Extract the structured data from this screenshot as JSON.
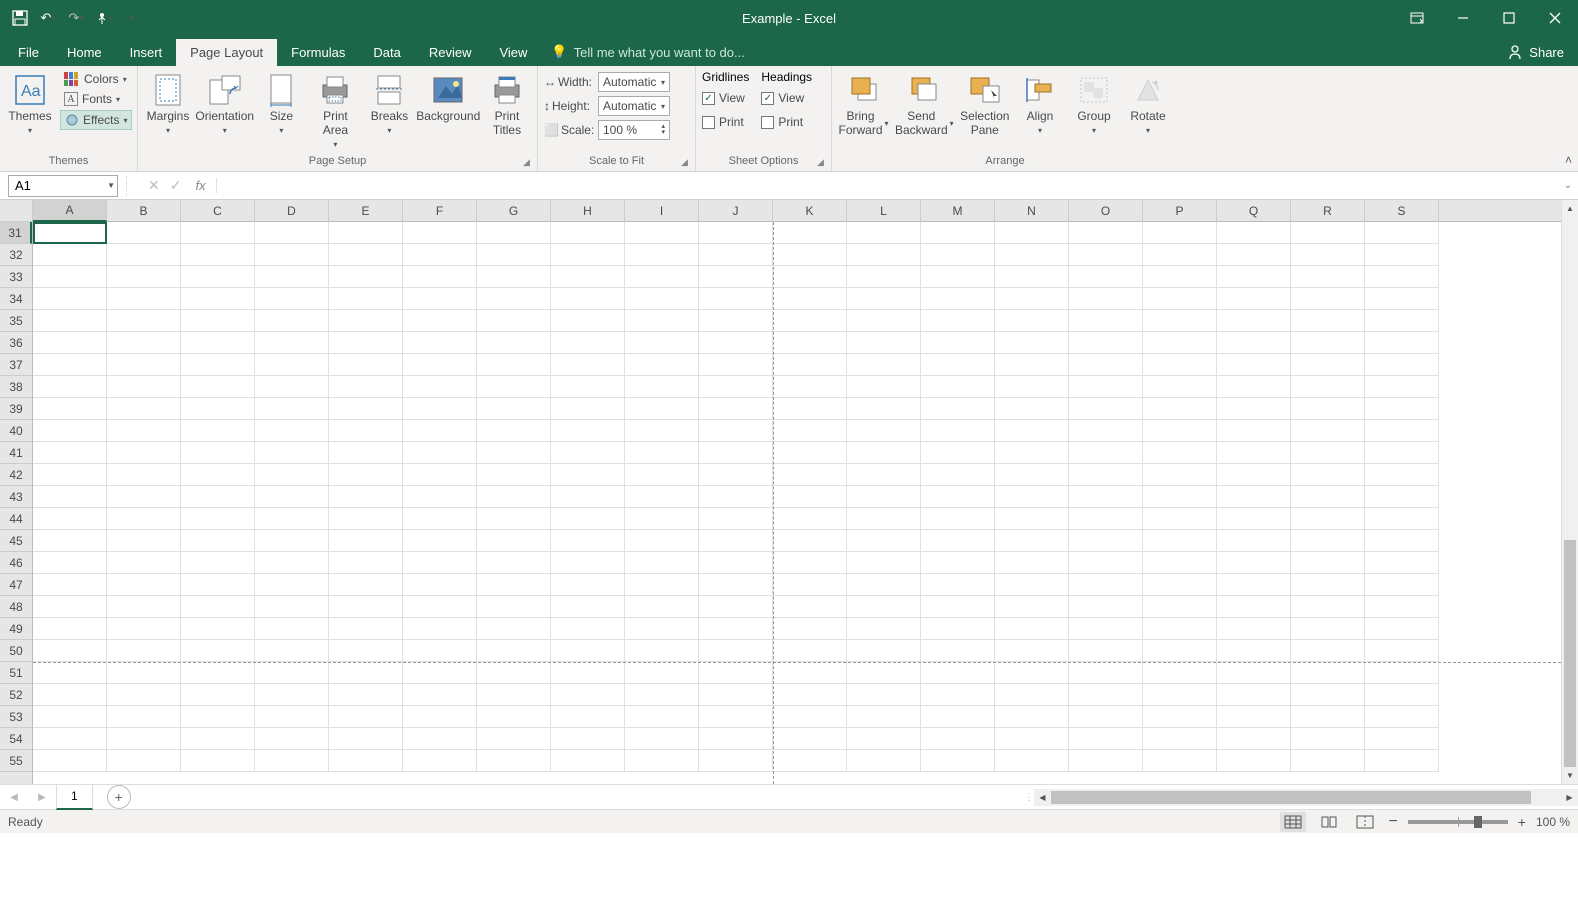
{
  "title": "Example - Excel",
  "tabs": {
    "file": "File",
    "home": "Home",
    "insert": "Insert",
    "page_layout": "Page Layout",
    "formulas": "Formulas",
    "data": "Data",
    "review": "Review",
    "view": "View",
    "tellme": "Tell me what you want to do..."
  },
  "share": "Share",
  "ribbon": {
    "themes": {
      "label": "Themes",
      "themes_btn": "Themes",
      "colors": "Colors",
      "fonts": "Fonts",
      "effects": "Effects"
    },
    "page_setup": {
      "label": "Page Setup",
      "margins": "Margins",
      "orientation": "Orientation",
      "size": "Size",
      "print_area": "Print\nArea",
      "breaks": "Breaks",
      "background": "Background",
      "print_titles": "Print\nTitles"
    },
    "scale": {
      "label": "Scale to Fit",
      "width": "Width:",
      "width_val": "Automatic",
      "height": "Height:",
      "height_val": "Automatic",
      "scale": "Scale:",
      "scale_val": "100 %"
    },
    "sheet_options": {
      "label": "Sheet Options",
      "gridlines": "Gridlines",
      "headings": "Headings",
      "view": "View",
      "print": "Print",
      "gridlines_view": true,
      "gridlines_print": false,
      "headings_view": true,
      "headings_print": false
    },
    "arrange": {
      "label": "Arrange",
      "bring_forward": "Bring\nForward",
      "send_backward": "Send\nBackward",
      "selection_pane": "Selection\nPane",
      "align": "Align",
      "group": "Group",
      "rotate": "Rotate"
    }
  },
  "namebox": "A1",
  "sheet": {
    "name": "1"
  },
  "columns": [
    "A",
    "B",
    "C",
    "D",
    "E",
    "F",
    "G",
    "H",
    "I",
    "J",
    "K",
    "L",
    "M",
    "N",
    "O",
    "P",
    "Q",
    "R",
    "S"
  ],
  "rows_start": 31,
  "rows_end": 55,
  "selected_cell": {
    "col": "A",
    "row": 31
  },
  "page_break": {
    "col_after": "J",
    "row_after": 50
  },
  "status": {
    "ready": "Ready",
    "zoom": "100 %"
  }
}
